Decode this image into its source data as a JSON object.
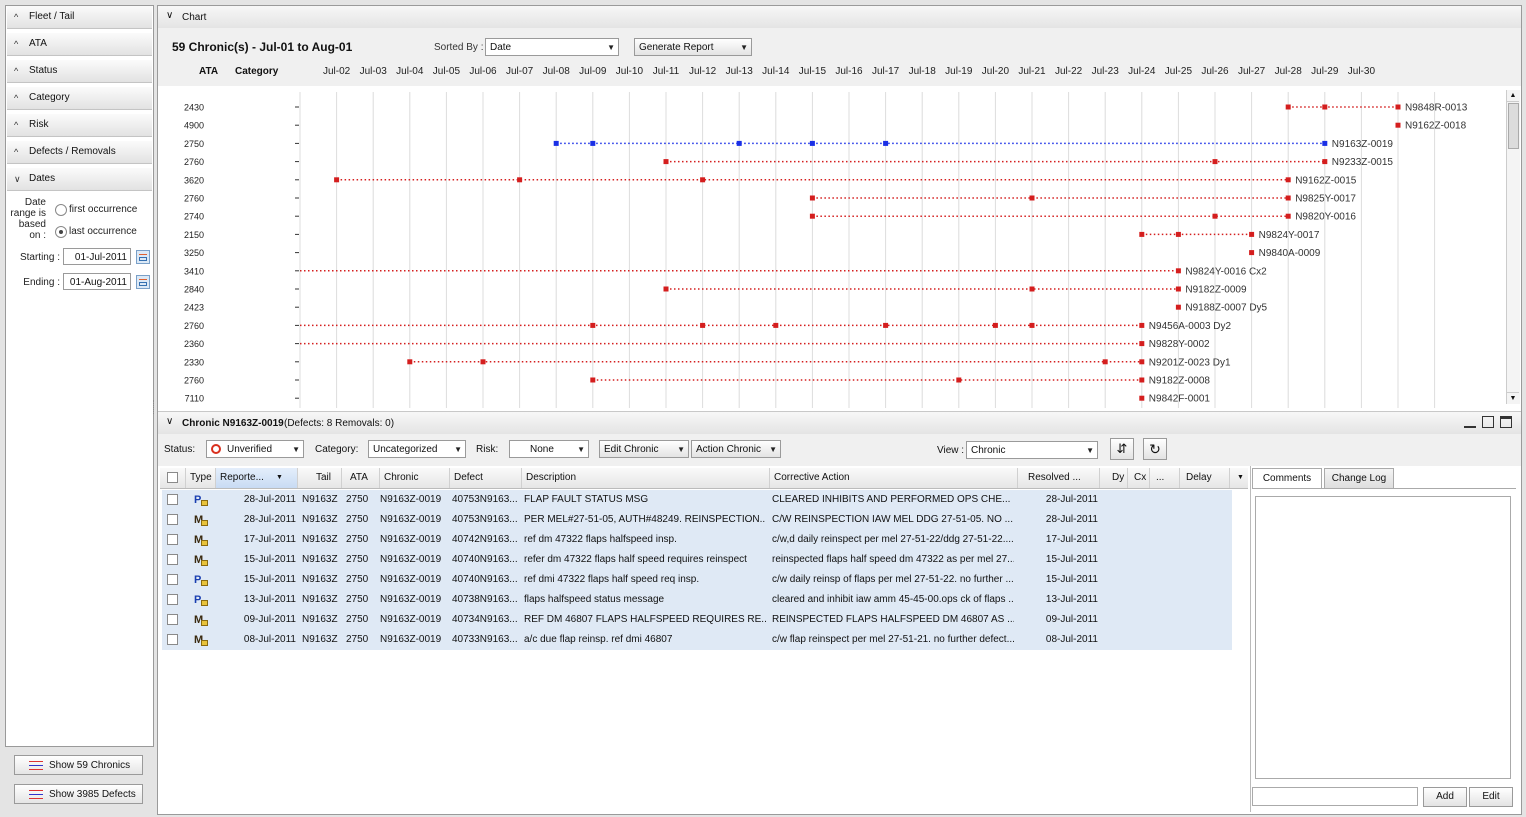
{
  "left_panel": {
    "sections": [
      "Fleet / Tail",
      "ATA",
      "Status",
      "Category",
      "Risk",
      "Defects / Removals",
      "Dates"
    ],
    "date_basis_label": [
      "Date",
      "range is",
      "based",
      "on :"
    ],
    "options": [
      "first occurrence",
      "last occurrence"
    ],
    "selected_option": "last occurrence",
    "starting_label": "Starting :",
    "starting_value": "01-Jul-2011",
    "ending_label": "Ending :",
    "ending_value": "01-Aug-2011",
    "show_chronics_button": "Show 59 Chronics",
    "show_defects_button": "Show 3985 Defects"
  },
  "chart_panel": {
    "header": "Chart",
    "title": "59 Chronic(s) - Jul-01 to Aug-01",
    "sorted_by_label": "Sorted By :",
    "sorted_by_value": "Date",
    "generate_report": "Generate Report",
    "col_ata": "ATA",
    "col_category": "Category"
  },
  "chart_data": {
    "type": "timeline",
    "x_labels": [
      "Jul-02",
      "Jul-03",
      "Jul-04",
      "Jul-05",
      "Jul-06",
      "Jul-07",
      "Jul-08",
      "Jul-09",
      "Jul-10",
      "Jul-11",
      "Jul-12",
      "Jul-13",
      "Jul-14",
      "Jul-15",
      "Jul-16",
      "Jul-17",
      "Jul-18",
      "Jul-19",
      "Jul-20",
      "Jul-21",
      "Jul-22",
      "Jul-23",
      "Jul-24",
      "Jul-25",
      "Jul-26",
      "Jul-27",
      "Jul-28",
      "Jul-29",
      "Jul-30"
    ],
    "x_range": [
      1,
      31
    ],
    "series_colors": {
      "selected": "#1a2fe6",
      "other": "#d41e1e"
    },
    "rows": [
      {
        "ata": "2430",
        "label": "N9848R-0013",
        "dates": [
          28,
          29,
          31
        ],
        "line_from": 28
      },
      {
        "ata": "4900",
        "label": "N9162Z-0018",
        "dates": [
          31
        ],
        "line_from": 31
      },
      {
        "ata": "2750",
        "label": "N9163Z-0019",
        "dates": [
          8,
          9,
          13,
          15,
          17,
          29
        ],
        "line_from": 8,
        "selected": true
      },
      {
        "ata": "2760",
        "label": "N9233Z-0015",
        "dates": [
          11,
          26,
          29
        ],
        "line_from": 11
      },
      {
        "ata": "3620",
        "label": "N9162Z-0015",
        "dates": [
          2,
          7,
          12,
          28
        ],
        "line_from": 2
      },
      {
        "ata": "2760",
        "label": "N9825Y-0017",
        "dates": [
          15,
          21,
          28
        ],
        "line_from": 15
      },
      {
        "ata": "2740",
        "label": "N9820Y-0016",
        "dates": [
          15,
          26,
          28
        ],
        "line_from": 15
      },
      {
        "ata": "2150",
        "label": "N9824Y-0017",
        "dates": [
          24,
          25,
          27
        ],
        "line_from": 24
      },
      {
        "ata": "3250",
        "label": "N9840A-0009",
        "dates": [
          27
        ],
        "line_from": 27
      },
      {
        "ata": "3410",
        "label": "N9824Y-0016 Cx2",
        "dates": [
          25
        ],
        "line_from": 1
      },
      {
        "ata": "2840",
        "label": "N9182Z-0009",
        "dates": [
          11,
          21,
          25
        ],
        "line_from": 11
      },
      {
        "ata": "2423",
        "label": "N9188Z-0007 Dy5",
        "dates": [
          25
        ],
        "line_from": 25
      },
      {
        "ata": "2760",
        "label": "N9456A-0003 Dy2",
        "dates": [
          9,
          12,
          14,
          17,
          20,
          21,
          24
        ],
        "line_from": 1
      },
      {
        "ata": "2360",
        "label": "N9828Y-0002",
        "dates": [
          24
        ],
        "line_from": 1
      },
      {
        "ata": "2330",
        "label": "N9201Z-0023 Dy1",
        "dates": [
          4,
          6,
          23,
          24
        ],
        "line_from": 4
      },
      {
        "ata": "2760",
        "label": "N9182Z-0008",
        "dates": [
          9,
          19,
          24
        ],
        "line_from": 9
      },
      {
        "ata": "7110",
        "label": "N9842F-0001",
        "dates": [
          24
        ],
        "line_from": 24
      }
    ]
  },
  "chronic_panel": {
    "title": "Chronic N9163Z-0019",
    "subtitle": "(Defects: 8 Removals: 0)",
    "status_label": "Status:",
    "status_value": "Unverified",
    "category_label": "Category:",
    "category_value": "Uncategorized",
    "risk_label": "Risk:",
    "risk_value": "None",
    "edit_chronic": "Edit Chronic",
    "action_chronic": "Action Chronic",
    "view_label": "View :",
    "view_value": "Chronic"
  },
  "table": {
    "headers": [
      "Type",
      "Reporte...",
      "Tail",
      "ATA",
      "Chronic",
      "Defect",
      "Description",
      "Corrective Action",
      "Resolved ...",
      "Dy",
      "Cx",
      "...",
      "Delay"
    ],
    "rows": [
      {
        "type": "P",
        "reported": "28-Jul-2011",
        "tail": "N9163Z",
        "ata": "2750",
        "chronic": "N9163Z-0019",
        "defect": "40753N9163...",
        "description": "FLAP FAULT STATUS MSG",
        "corrective": "CLEARED INHIBITS AND PERFORMED OPS CHE...",
        "resolved": "28-Jul-2011"
      },
      {
        "type": "M",
        "reported": "28-Jul-2011",
        "tail": "N9163Z",
        "ata": "2750",
        "chronic": "N9163Z-0019",
        "defect": "40753N9163...",
        "description": "PER MEL#27-51-05, AUTH#48249. REINSPECTION...",
        "corrective": "C/W REINSPECTION IAW MEL DDG 27-51-05. NO ...",
        "resolved": "28-Jul-2011"
      },
      {
        "type": "M",
        "reported": "17-Jul-2011",
        "tail": "N9163Z",
        "ata": "2750",
        "chronic": "N9163Z-0019",
        "defect": "40742N9163...",
        "description": "ref dm 47322 flaps halfspeed insp.",
        "corrective": "c/w,d daily reinspect per mel 27-51-22/ddg 27-51-22....",
        "resolved": "17-Jul-2011"
      },
      {
        "type": "M",
        "reported": "15-Jul-2011",
        "tail": "N9163Z",
        "ata": "2750",
        "chronic": "N9163Z-0019",
        "defect": "40740N9163...",
        "description": "refer dm 47322 flaps half speed requires reinspect",
        "corrective": "reinspected flaps half speed dm 47322 as per mel 27...",
        "resolved": "15-Jul-2011"
      },
      {
        "type": "P",
        "reported": "15-Jul-2011",
        "tail": "N9163Z",
        "ata": "2750",
        "chronic": "N9163Z-0019",
        "defect": "40740N9163...",
        "description": "ref dmi 47322 flaps half speed req insp.",
        "corrective": "c/w daily reinsp of flaps per mel 27-51-22. no further ...",
        "resolved": "15-Jul-2011"
      },
      {
        "type": "P",
        "reported": "13-Jul-2011",
        "tail": "N9163Z",
        "ata": "2750",
        "chronic": "N9163Z-0019",
        "defect": "40738N9163...",
        "description": "flaps halfspeed status message",
        "corrective": "cleared and inhibit iaw amm 45-45-00.ops ck of flaps ...",
        "resolved": "13-Jul-2011"
      },
      {
        "type": "M",
        "reported": "09-Jul-2011",
        "tail": "N9163Z",
        "ata": "2750",
        "chronic": "N9163Z-0019",
        "defect": "40734N9163...",
        "description": "REF DM 46807 FLAPS HALFSPEED REQUIRES RE...",
        "corrective": "REINSPECTED FLAPS HALFSPEED DM 46807 AS ...",
        "resolved": "09-Jul-2011"
      },
      {
        "type": "M",
        "reported": "08-Jul-2011",
        "tail": "N9163Z",
        "ata": "2750",
        "chronic": "N9163Z-0019",
        "defect": "40733N9163...",
        "description": "a/c due flap reinsp. ref dmi 46807",
        "corrective": "c/w flap reinspect per mel 27-51-21. no further defect...",
        "resolved": "08-Jul-2011"
      }
    ]
  },
  "side_tabs": {
    "comments": "Comments",
    "change_log": "Change Log",
    "add": "Add",
    "edit": "Edit"
  }
}
